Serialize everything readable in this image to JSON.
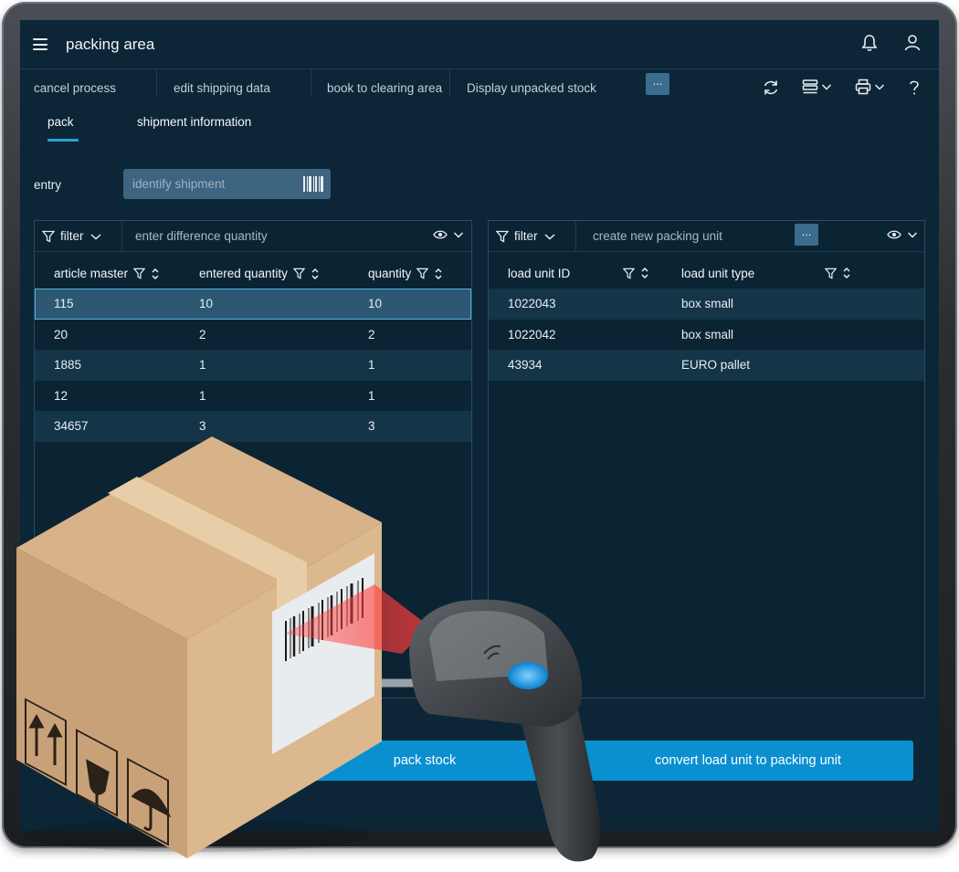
{
  "app": {
    "title": "packing area"
  },
  "toolbar": {
    "items": [
      "cancel process",
      "edit shipping data",
      "book to clearing area",
      "Display unpacked stock"
    ],
    "more_label": "..."
  },
  "tabs": [
    {
      "label": "pack",
      "active": true
    },
    {
      "label": "shipment information",
      "active": false
    }
  ],
  "entry": {
    "label": "entry",
    "placeholder": "identify shipment"
  },
  "left_panel": {
    "filter_label": "filter",
    "action_placeholder": "enter difference quantity",
    "columns": [
      "article master",
      "entered quantity",
      "quantity"
    ],
    "rows": [
      [
        "115",
        "10",
        "10"
      ],
      [
        "20",
        "2",
        "2"
      ],
      [
        "1885",
        "1",
        "1"
      ],
      [
        "12",
        "1",
        "1"
      ],
      [
        "34657",
        "3",
        "3"
      ]
    ],
    "selected_row": 0
  },
  "right_panel": {
    "filter_label": "filter",
    "action_placeholder": "create new packing unit",
    "more_label": "...",
    "columns": [
      "load unit ID",
      "load unit type"
    ],
    "rows": [
      [
        "1022043",
        "box small"
      ],
      [
        "1022042",
        "box small"
      ],
      [
        "43934",
        "EURO pallet"
      ]
    ]
  },
  "actions": {
    "pack_stock": "pack stock",
    "convert": "convert load unit to packing unit"
  },
  "colors": {
    "background": "#0c2637",
    "accent": "#0a8fd0",
    "selection": "#2c5873",
    "tab_indicator": "#27a3d9"
  },
  "icons": [
    "menu-icon",
    "bell-icon",
    "user-icon",
    "refresh-icon",
    "layout-icon",
    "print-icon",
    "help-icon",
    "filter-icon",
    "sort-icon",
    "eye-icon",
    "chevron-down-icon",
    "barcode-icon"
  ]
}
